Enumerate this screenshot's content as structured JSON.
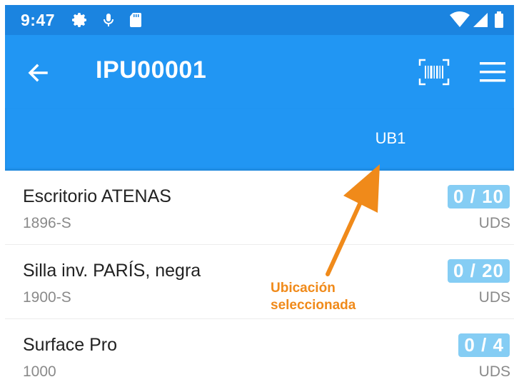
{
  "status_bar": {
    "time": "9:47",
    "icons": [
      "gear-icon",
      "mic-icon",
      "sd-card-icon",
      "wifi-icon",
      "signal-icon",
      "battery-icon"
    ]
  },
  "app_bar": {
    "title": "IPU00001",
    "back_icon": "arrow-back-icon",
    "scan_icon": "barcode-scan-icon",
    "menu_icon": "hamburger-menu-icon"
  },
  "tabs": [
    {
      "label": "UB1",
      "selected": true
    }
  ],
  "items": [
    {
      "name": "Escritorio ATENAS",
      "code": "1896-S",
      "quantity": "0 / 10",
      "unit": "UDS"
    },
    {
      "name": "Silla inv. PARÍS, negra",
      "code": "1900-S",
      "quantity": "0 / 20",
      "unit": "UDS"
    },
    {
      "name": "Surface Pro",
      "code": "1000",
      "quantity": "0 / 4",
      "unit": "UDS"
    }
  ],
  "annotation": {
    "line1": "Ubicación",
    "line2": "seleccionada"
  },
  "colors": {
    "status_bar": "#1b84e0",
    "app_bar": "#2196f3",
    "qty_badge": "#85cdf4",
    "annotation": "#f08a1a"
  }
}
